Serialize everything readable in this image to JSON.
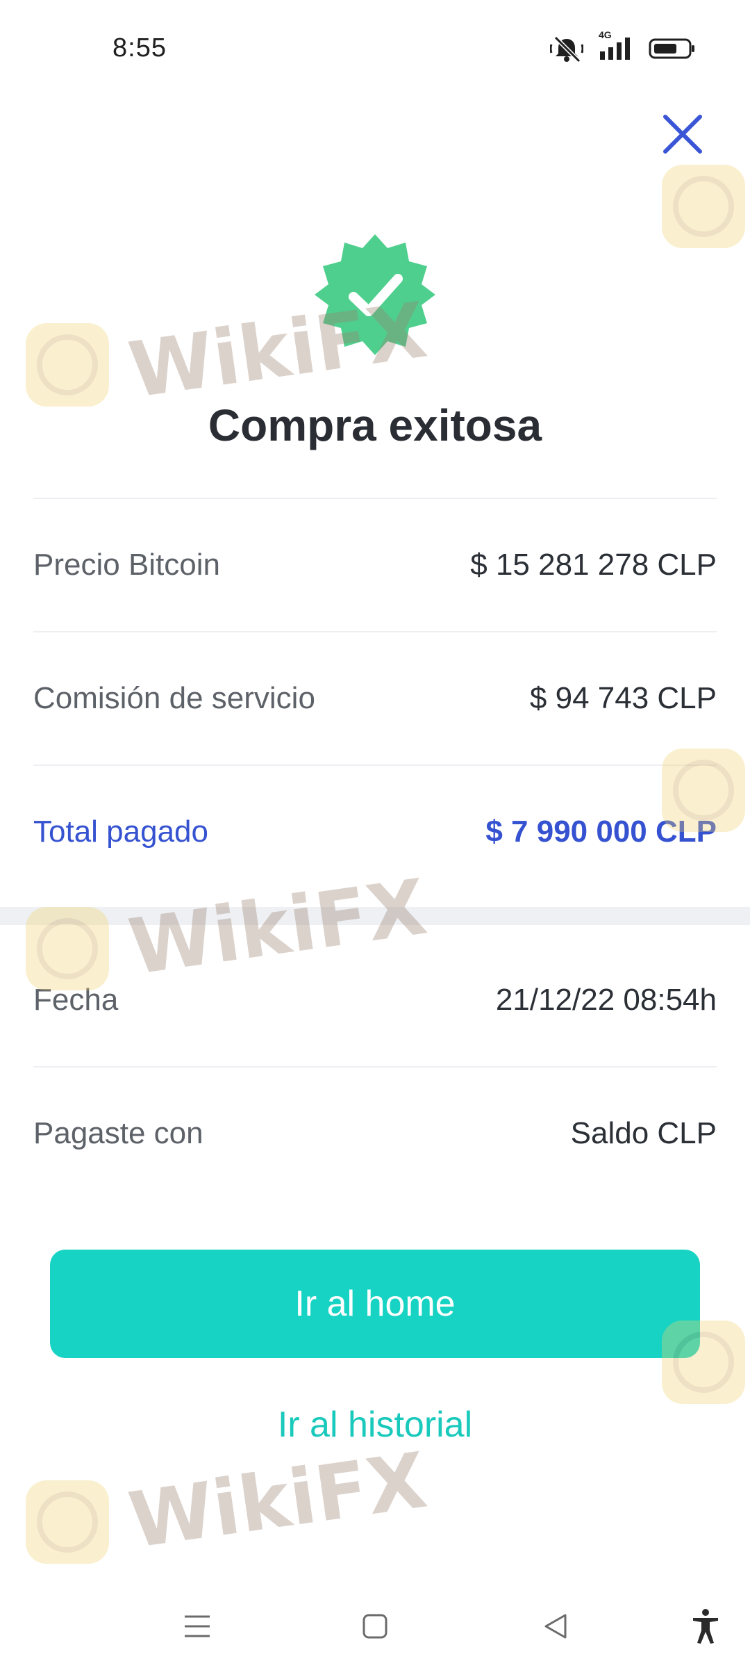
{
  "status_bar": {
    "time": "8:55",
    "network": "4G",
    "icons": [
      "mute-icon",
      "signal-icon",
      "battery-icon"
    ]
  },
  "header": {
    "close_icon": "close-icon"
  },
  "success": {
    "title": "Compra exitosa",
    "badge_color": "#4fcf8e"
  },
  "details": {
    "rows": [
      {
        "label": "Precio Bitcoin",
        "value": "$ 15 281 278 CLP"
      },
      {
        "label": "Comisión de servicio",
        "value": "$ 94 743 CLP"
      },
      {
        "label": "Total pagado",
        "value": "$ 7 990 000 CLP"
      }
    ],
    "meta": [
      {
        "label": "Fecha",
        "value": "21/12/22 08:54h"
      },
      {
        "label": "Pagaste con",
        "value": "Saldo CLP"
      }
    ]
  },
  "actions": {
    "primary_label": "Ir al home",
    "secondary_label": "Ir al historial"
  },
  "watermark": {
    "text": "WikiFX"
  },
  "colors": {
    "accent_blue": "#3552d1",
    "teal": "#17d3c3",
    "success_green": "#4fcf8e"
  },
  "nav_bar": {
    "icons": [
      "menu-icon",
      "home-square-icon",
      "back-icon",
      "accessibility-icon"
    ]
  }
}
